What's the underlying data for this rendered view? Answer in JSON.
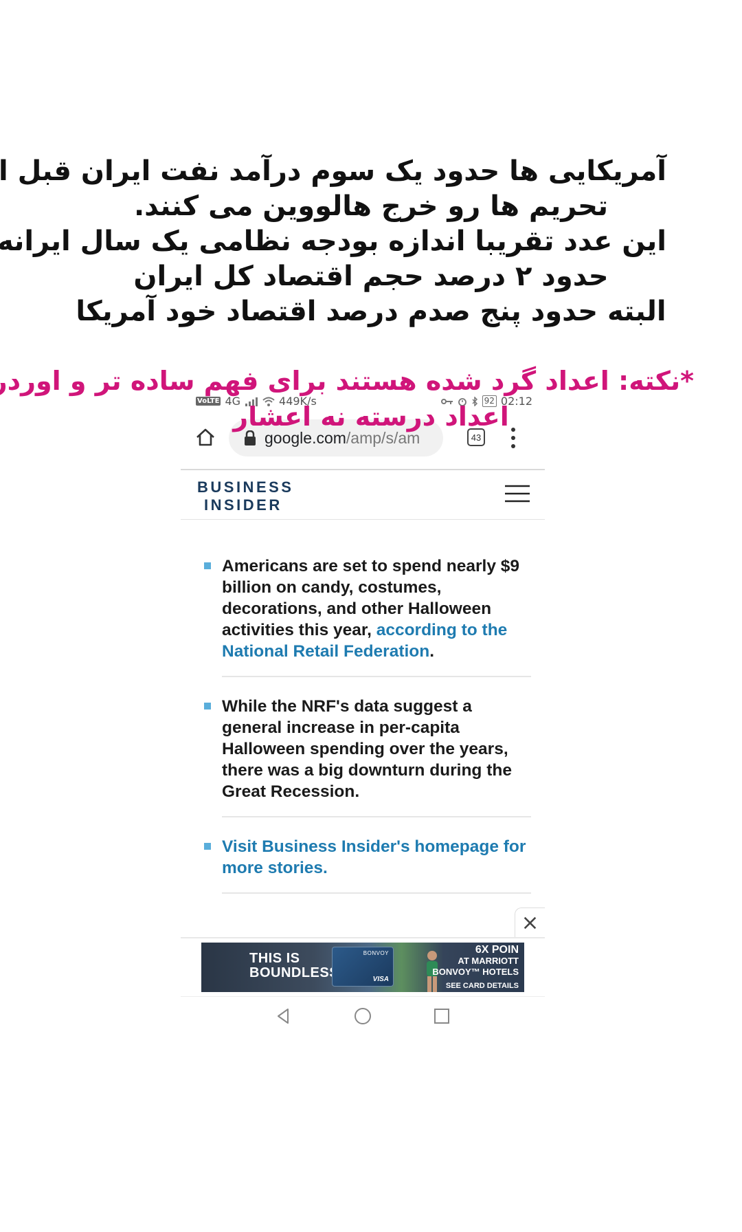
{
  "overlay": {
    "lines": [
      "آمریکایی ها حدود یک سوم درآمد نفت ایران قبل از",
      "تحریم ها رو خرج هالووین می کنند.",
      "این عدد تقریبا اندازه بودجه نظامی یک سال ایرانه.",
      "حدود ۲ درصد حجم اقتصاد کل ایران",
      "البته حدود پنج صدم درصد اقتصاد خود آمریکا"
    ],
    "note_lines": [
      "*نکته: اعداد گرد شده هستند برای فهم ساده تر و اوردر",
      "اعداد درسته نه اعشار"
    ],
    "note_color": "#d0157a"
  },
  "status_bar": {
    "network": "4G",
    "speed": "449K/s",
    "battery": "92",
    "time": "02:12"
  },
  "browser": {
    "url_host": "google.com",
    "url_path": "/amp/s/am",
    "tab_count": "43"
  },
  "site": {
    "logo_line1": "BUSINESS",
    "logo_line2": "INSIDER",
    "brand_color": "#1a3a5c",
    "link_color": "#1e7bb0",
    "bullet_color": "#5aaedb"
  },
  "article": {
    "bullet1": {
      "text": "Americans are set to spend nearly $9 billion on candy, costumes, decorations, and other Halloween activities this year, ",
      "link": "according to the National Retail Federation",
      "end": "."
    },
    "bullet2": {
      "text": "While the NRF's data suggest a general increase in per-capita Halloween spending over the years, there was a big downturn during the Great Recession."
    },
    "bullet3": {
      "link": "Visit Business Insider's homepage for more stories."
    }
  },
  "ad": {
    "headline_line1": "THIS IS",
    "headline_line2": "BOUNDLESS",
    "card_brand": "BONVOY",
    "card_network": "VISA",
    "right_line1": "6X POIN",
    "right_line2": "AT MARRIOTT",
    "right_line3": "BONVOY™ HOTELS",
    "cta": "SEE CARD DETAILS"
  }
}
